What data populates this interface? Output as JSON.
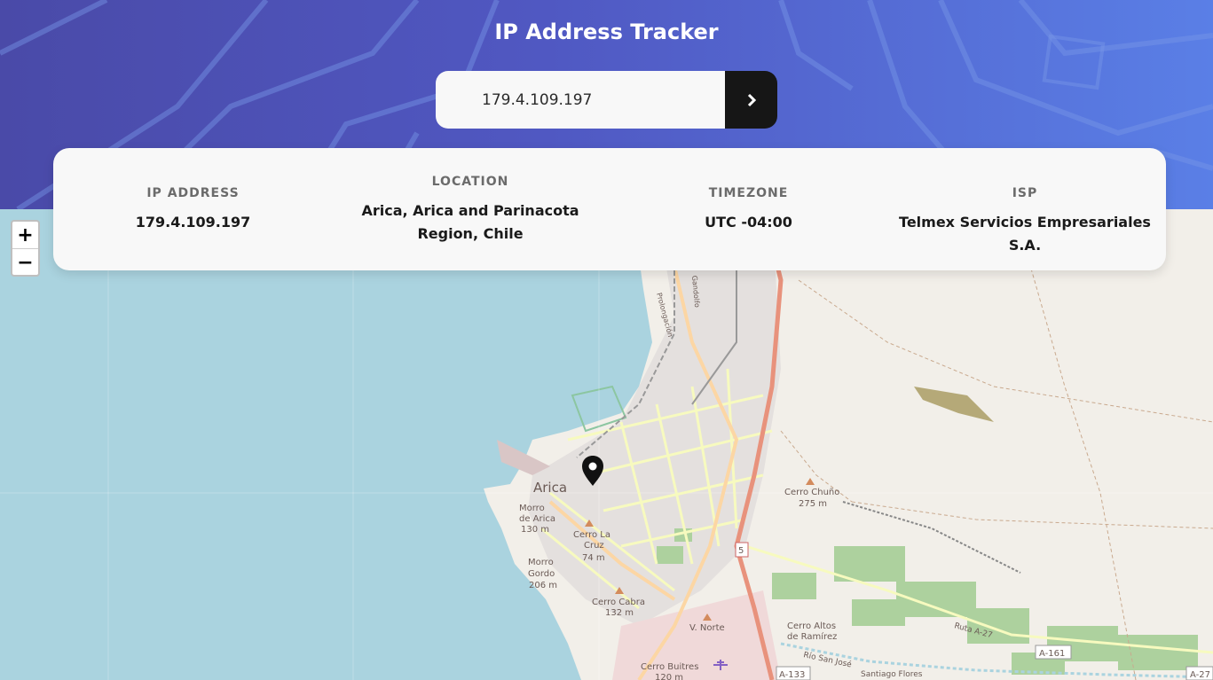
{
  "header": {
    "title": "IP Address Tracker"
  },
  "search": {
    "value": "179.4.109.197",
    "submit_icon": "chevron-right-icon"
  },
  "info": {
    "ip": {
      "label": "IP ADDRESS",
      "value": "179.4.109.197"
    },
    "location": {
      "label": "LOCATION",
      "value": "Arica, Arica and Parinacota Region, Chile"
    },
    "timezone": {
      "label": "TIMEZONE",
      "value": "UTC -04:00"
    },
    "isp": {
      "label": "ISP",
      "value": "Telmex Servicios Empresariales S.A."
    }
  },
  "map": {
    "zoom_in": "+",
    "zoom_out": "−",
    "marker_icon": "location-pin-icon",
    "labels": {
      "city": "Arica",
      "morro_arica": "Morro",
      "morro_arica2": "de Arica",
      "morro_arica_h": "130 m",
      "cerro_la_cruz": "Cerro La",
      "cerro_la_cruz2": "Cruz",
      "cerro_la_cruz_h": "74 m",
      "morro_gordo": "Morro",
      "morro_gordo2": "Gordo",
      "morro_gordo_h": "206 m",
      "cerro_cabra": "Cerro Cabra",
      "cerro_cabra_h": "132 m",
      "v_norte": "V. Norte",
      "cerro_buitres": "Cerro Buitres",
      "cerro_buitres_h": "120 m",
      "cerro_chuno": "Cerro Chuño",
      "cerro_chuno_h": "275 m",
      "cerro_altos": "Cerro Altos",
      "cerro_altos2": "de Ramírez",
      "rio_san_jose": "Río San José",
      "ruta_a27": "Ruta A-27",
      "a161": "A-161",
      "a133": "A-133",
      "a27": "A-27",
      "route5": "5",
      "santiago_flores": "Santiago Flores",
      "gandolfo": "Gandolfo",
      "prolongacion": "Prolongación"
    }
  }
}
